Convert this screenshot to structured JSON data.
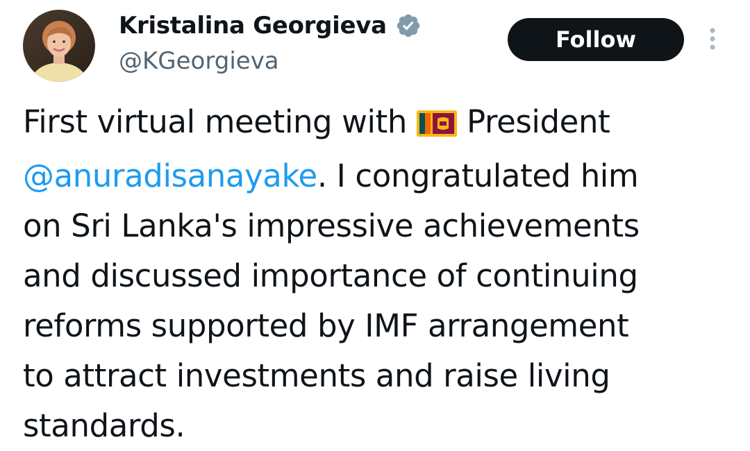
{
  "author": {
    "display_name": "Kristalina Georgieva",
    "handle": "@KGeorgieva",
    "verified_icon": "verified-badge-icon",
    "avatar_icon": "avatar"
  },
  "actions": {
    "follow_label": "Follow",
    "more_icon": "more-vertical-icon"
  },
  "tweet": {
    "line1_before_flag": "First virtual meeting with",
    "flag_icon": "sri-lanka-flag-icon",
    "line1_after_flag": "President",
    "mention": "@anuradisanayake",
    "line2_after_mention": ". I congratulated him",
    "line3": "on Sri Lanka's impressive achievements",
    "line4": "and discussed importance of continuing",
    "line5": "reforms supported by IMF arrangement",
    "line6": "to attract investments and raise living",
    "line7": "standards."
  },
  "colors": {
    "text": "#0f1419",
    "secondary_text": "#536471",
    "link": "#1d9bf0",
    "verified_badge": "#829aab",
    "button_bg": "#0f1419"
  }
}
